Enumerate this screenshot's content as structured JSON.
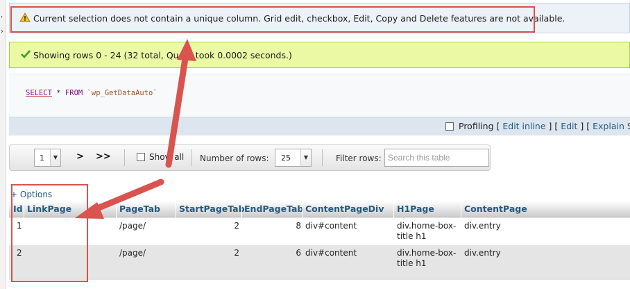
{
  "warning": {
    "message": "Current selection does not contain a unique column. Grid edit, checkbox, Edit, Copy and Delete features are not available."
  },
  "success": {
    "message": "Showing rows 0 - 24 (32 total, Query took 0.0002 seconds.)"
  },
  "sql": {
    "select": "SELECT",
    "star": "*",
    "from": "FROM",
    "table": "`wp_GetDataAuto`"
  },
  "profiling": {
    "label": "Profiling",
    "open1": "[",
    "edit_inline": "Edit inline",
    "close_open": "] [",
    "edit": "Edit",
    "close_open2": "] [",
    "explain_sql": "Explain SQL"
  },
  "navigation": {
    "page_value": "1",
    "next_label": ">",
    "last_label": ">>",
    "show_all_label": "Show all",
    "rows_label": "Number of rows:",
    "rows_value": "25",
    "filter_label": "Filter rows:",
    "filter_placeholder": "Search this table"
  },
  "options_link": "+ Options",
  "table": {
    "headers": [
      "Id",
      "LinkPage",
      "PageTab",
      "StartPageTab",
      "EndPageTab",
      "ContentPageDiv",
      "H1Page",
      "ContentPage"
    ],
    "rows": [
      {
        "id": "1",
        "linkpage": "",
        "pagetab": "/page/",
        "startpagetab": "2",
        "endpagetab": "8",
        "contentpagediv": "div#content",
        "h1page": "div.home-box-title h1",
        "contentpage": "div.entry"
      },
      {
        "id": "2",
        "linkpage": "",
        "pagetab": "/page/",
        "startpagetab": "2",
        "endpagetab": "6",
        "contentpagediv": "div#content",
        "h1page": "div.home-box-title h1",
        "contentpage": "div.entry"
      }
    ]
  },
  "colors": {
    "annotation": "#d9534f",
    "link": "#235a81",
    "success_bg": "#ebf8a4",
    "warning_bg": "#ecf2f8"
  }
}
